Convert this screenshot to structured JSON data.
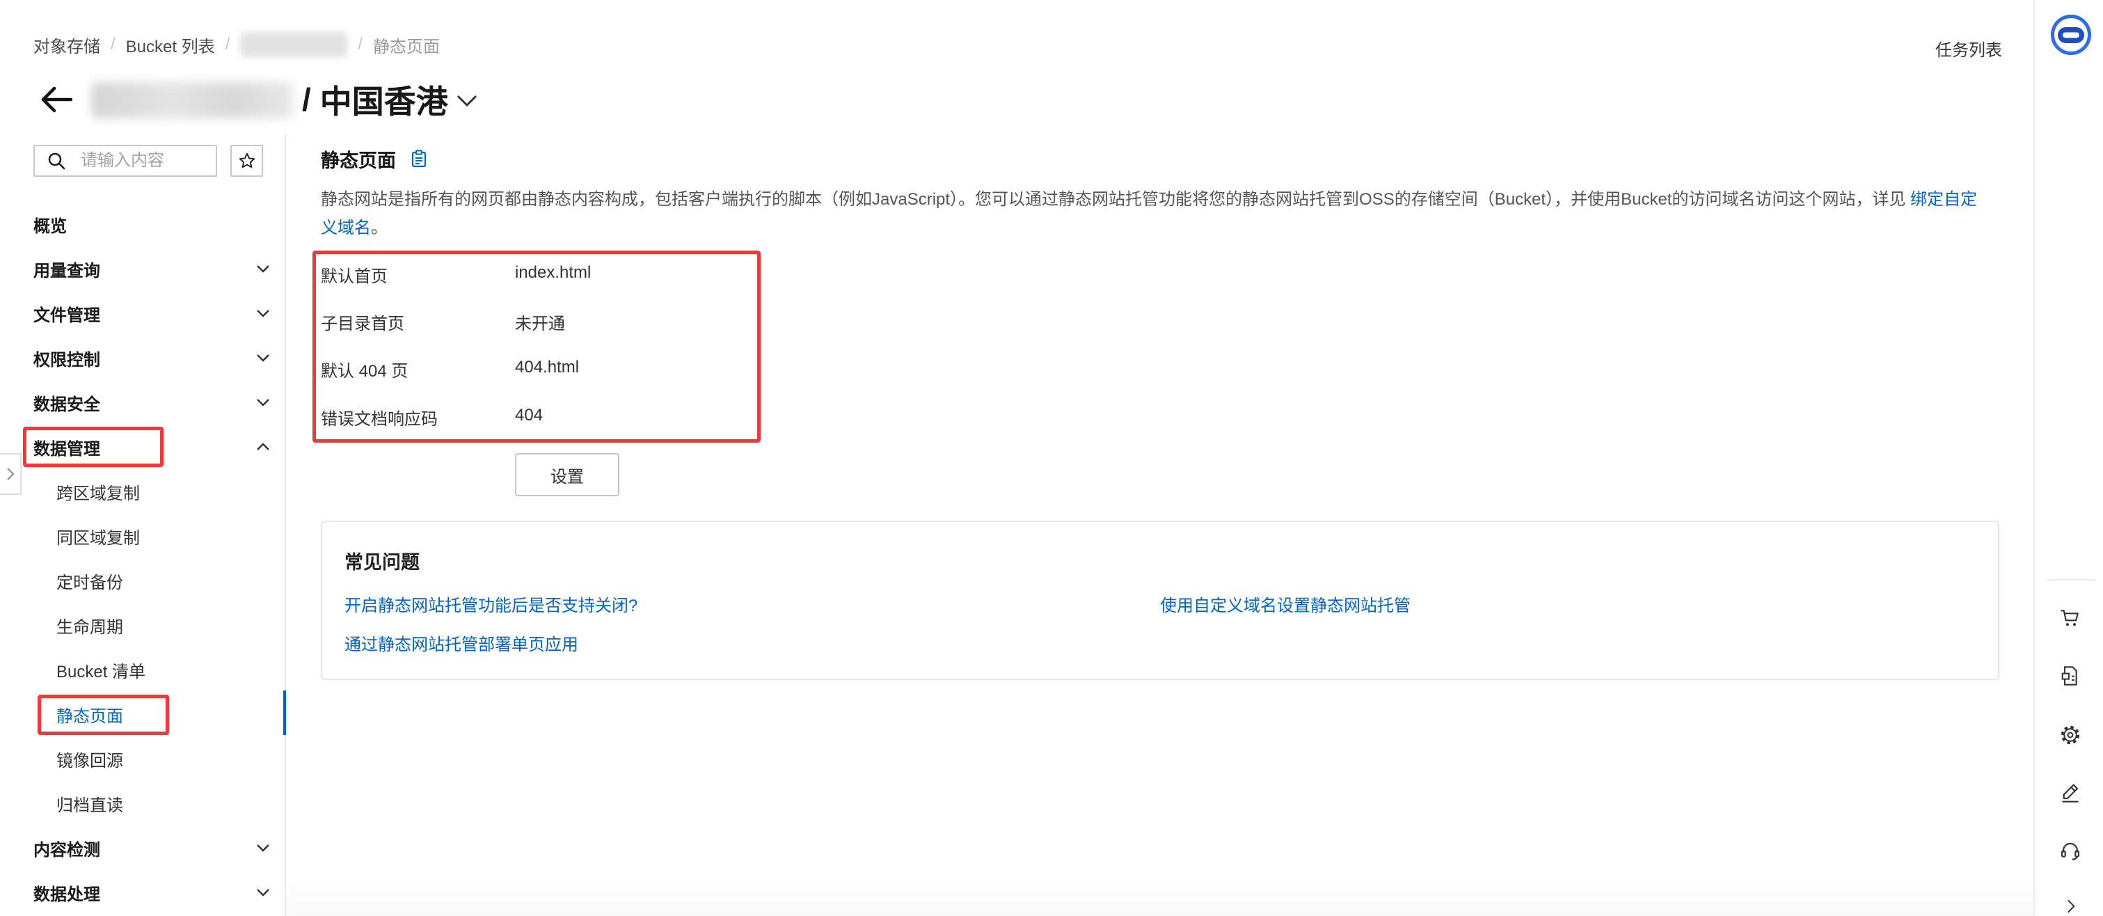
{
  "breadcrumb": {
    "root": "对象存储",
    "bucket_list": "Bucket 列表",
    "current": "静态页面",
    "separator": "/"
  },
  "header": {
    "separator": "/",
    "region": "中国香港",
    "task_list": "任务列表"
  },
  "sidebar": {
    "search_placeholder": "请输入内容",
    "items": [
      {
        "label": "概览"
      },
      {
        "label": "用量查询",
        "expandable": true,
        "expanded": false
      },
      {
        "label": "文件管理",
        "expandable": true,
        "expanded": false
      },
      {
        "label": "权限控制",
        "expandable": true,
        "expanded": false
      },
      {
        "label": "数据安全",
        "expandable": true,
        "expanded": false
      },
      {
        "label": "数据管理",
        "expandable": true,
        "expanded": true,
        "highlighted": true
      },
      {
        "label": "跨区域复制",
        "child": true
      },
      {
        "label": "同区域复制",
        "child": true
      },
      {
        "label": "定时备份",
        "child": true
      },
      {
        "label": "生命周期",
        "child": true
      },
      {
        "label": "Bucket 清单",
        "child": true
      },
      {
        "label": "静态页面",
        "child": true,
        "active": true,
        "highlighted": true
      },
      {
        "label": "镜像回源",
        "child": true
      },
      {
        "label": "归档直读",
        "child": true
      },
      {
        "label": "内容检测",
        "expandable": true,
        "expanded": false
      },
      {
        "label": "数据处理",
        "expandable": true,
        "expanded": false
      }
    ]
  },
  "main": {
    "title": "静态页面",
    "description": {
      "text": "静态网站是指所有的网页都由静态内容构成，包括客户端执行的脚本（例如JavaScript）。您可以通过静态网站托管功能将您的静态网站托管到OSS的存储空间（Bucket），并使用Bucket的访问域名访问这个网站，详见 ",
      "link": "绑定自定义域名",
      "end": "。"
    },
    "settings": [
      {
        "label": "默认首页",
        "value": "index.html"
      },
      {
        "label": "子目录首页",
        "value": "未开通"
      },
      {
        "label": "默认 404 页",
        "value": "404.html"
      },
      {
        "label": "错误文档响应码",
        "value": "404"
      }
    ],
    "settings_button": "设置",
    "faq": {
      "title": "常见问题",
      "links": [
        "开启静态网站托管功能后是否支持关闭?",
        "使用自定义域名设置静态网站托管",
        "通过静态网站托管部署单页应用"
      ]
    }
  },
  "right_rail": {
    "icons": [
      "assistant-avatar-icon",
      "cart-icon",
      "document-icon",
      "gear-icon",
      "edit-icon",
      "headset-icon",
      "chevron-right-icon"
    ]
  },
  "colors": {
    "accent": "#0064c8",
    "highlight_box": "#f0393b",
    "text": "#333333"
  }
}
